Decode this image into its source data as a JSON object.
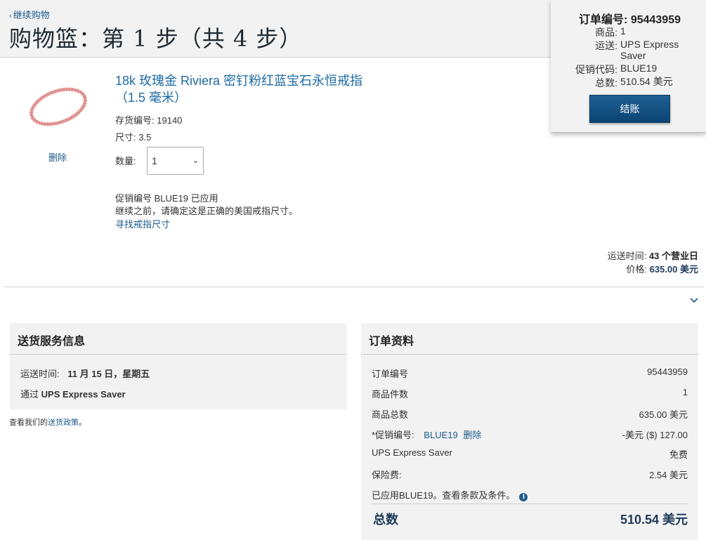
{
  "header": {
    "continue_label": "继续购物",
    "title": "购物篮：第 1 步（共 4 步）"
  },
  "summary": {
    "order_label": "订单编号:",
    "order_number": "95443959",
    "rows": [
      {
        "label": "商品:",
        "value": "1"
      },
      {
        "label": "运送:",
        "value": "UPS Express Saver"
      },
      {
        "label": "促销代码:",
        "value": "BLUE19"
      },
      {
        "label": "总数:",
        "value": "510.54 美元"
      }
    ],
    "checkout_label": "结账"
  },
  "item": {
    "title": "18k 玫瑰金 Riviera 密钉粉红蓝宝石永恒戒指（1.5 毫米）",
    "sku_label": "存货编号:",
    "sku": "19140",
    "size_label": "尺寸:",
    "size": "3.5",
    "qty_label": "数量:",
    "qty_value": "1",
    "delete_label": "删除",
    "promo_applied": "促销编号 BLUE19 已应用",
    "size_note": "继续之前，请确定这是正确的美国戒指尺寸。",
    "size_link": "寻找戒指尺寸",
    "ship_time_label": "运送时间:",
    "ship_time": "43 个营业日",
    "price_label": "价格:",
    "price": "635.00 美元",
    "ring_color": "#e7a98f",
    "stone_color": "#d77aa8"
  },
  "delivery": {
    "heading": "送货服务信息",
    "ship_label": "运送时间:",
    "ship_date": "11 月 15 日，星期五",
    "via_label": "通过",
    "carrier": "UPS Express Saver",
    "policy_prefix": "查看我们的",
    "policy_link": "送货政策",
    "policy_suffix": "。"
  },
  "order_details": {
    "heading": "订单资料",
    "rows": [
      {
        "label": "订单编号",
        "value": "95443959"
      },
      {
        "label": "商品件数",
        "value": "1"
      },
      {
        "label": "商品总数",
        "value": "635.00 美元"
      },
      {
        "label": "*促销编号:",
        "code": "BLUE19",
        "remove": "删除",
        "value": "-美元 ($) 127.00"
      },
      {
        "label": "UPS Express Saver",
        "value": "免费"
      },
      {
        "label": "保险费:",
        "value": "2.54 美元"
      }
    ],
    "terms_note": "已应用BLUE19。查看条款及条件。",
    "total_label": "总数",
    "total_value": "510.54 美元"
  },
  "colors": {
    "accent_blue": "#1c5a8c",
    "button_blue": "#0b4474",
    "panel_gray": "#f2f2f2"
  }
}
